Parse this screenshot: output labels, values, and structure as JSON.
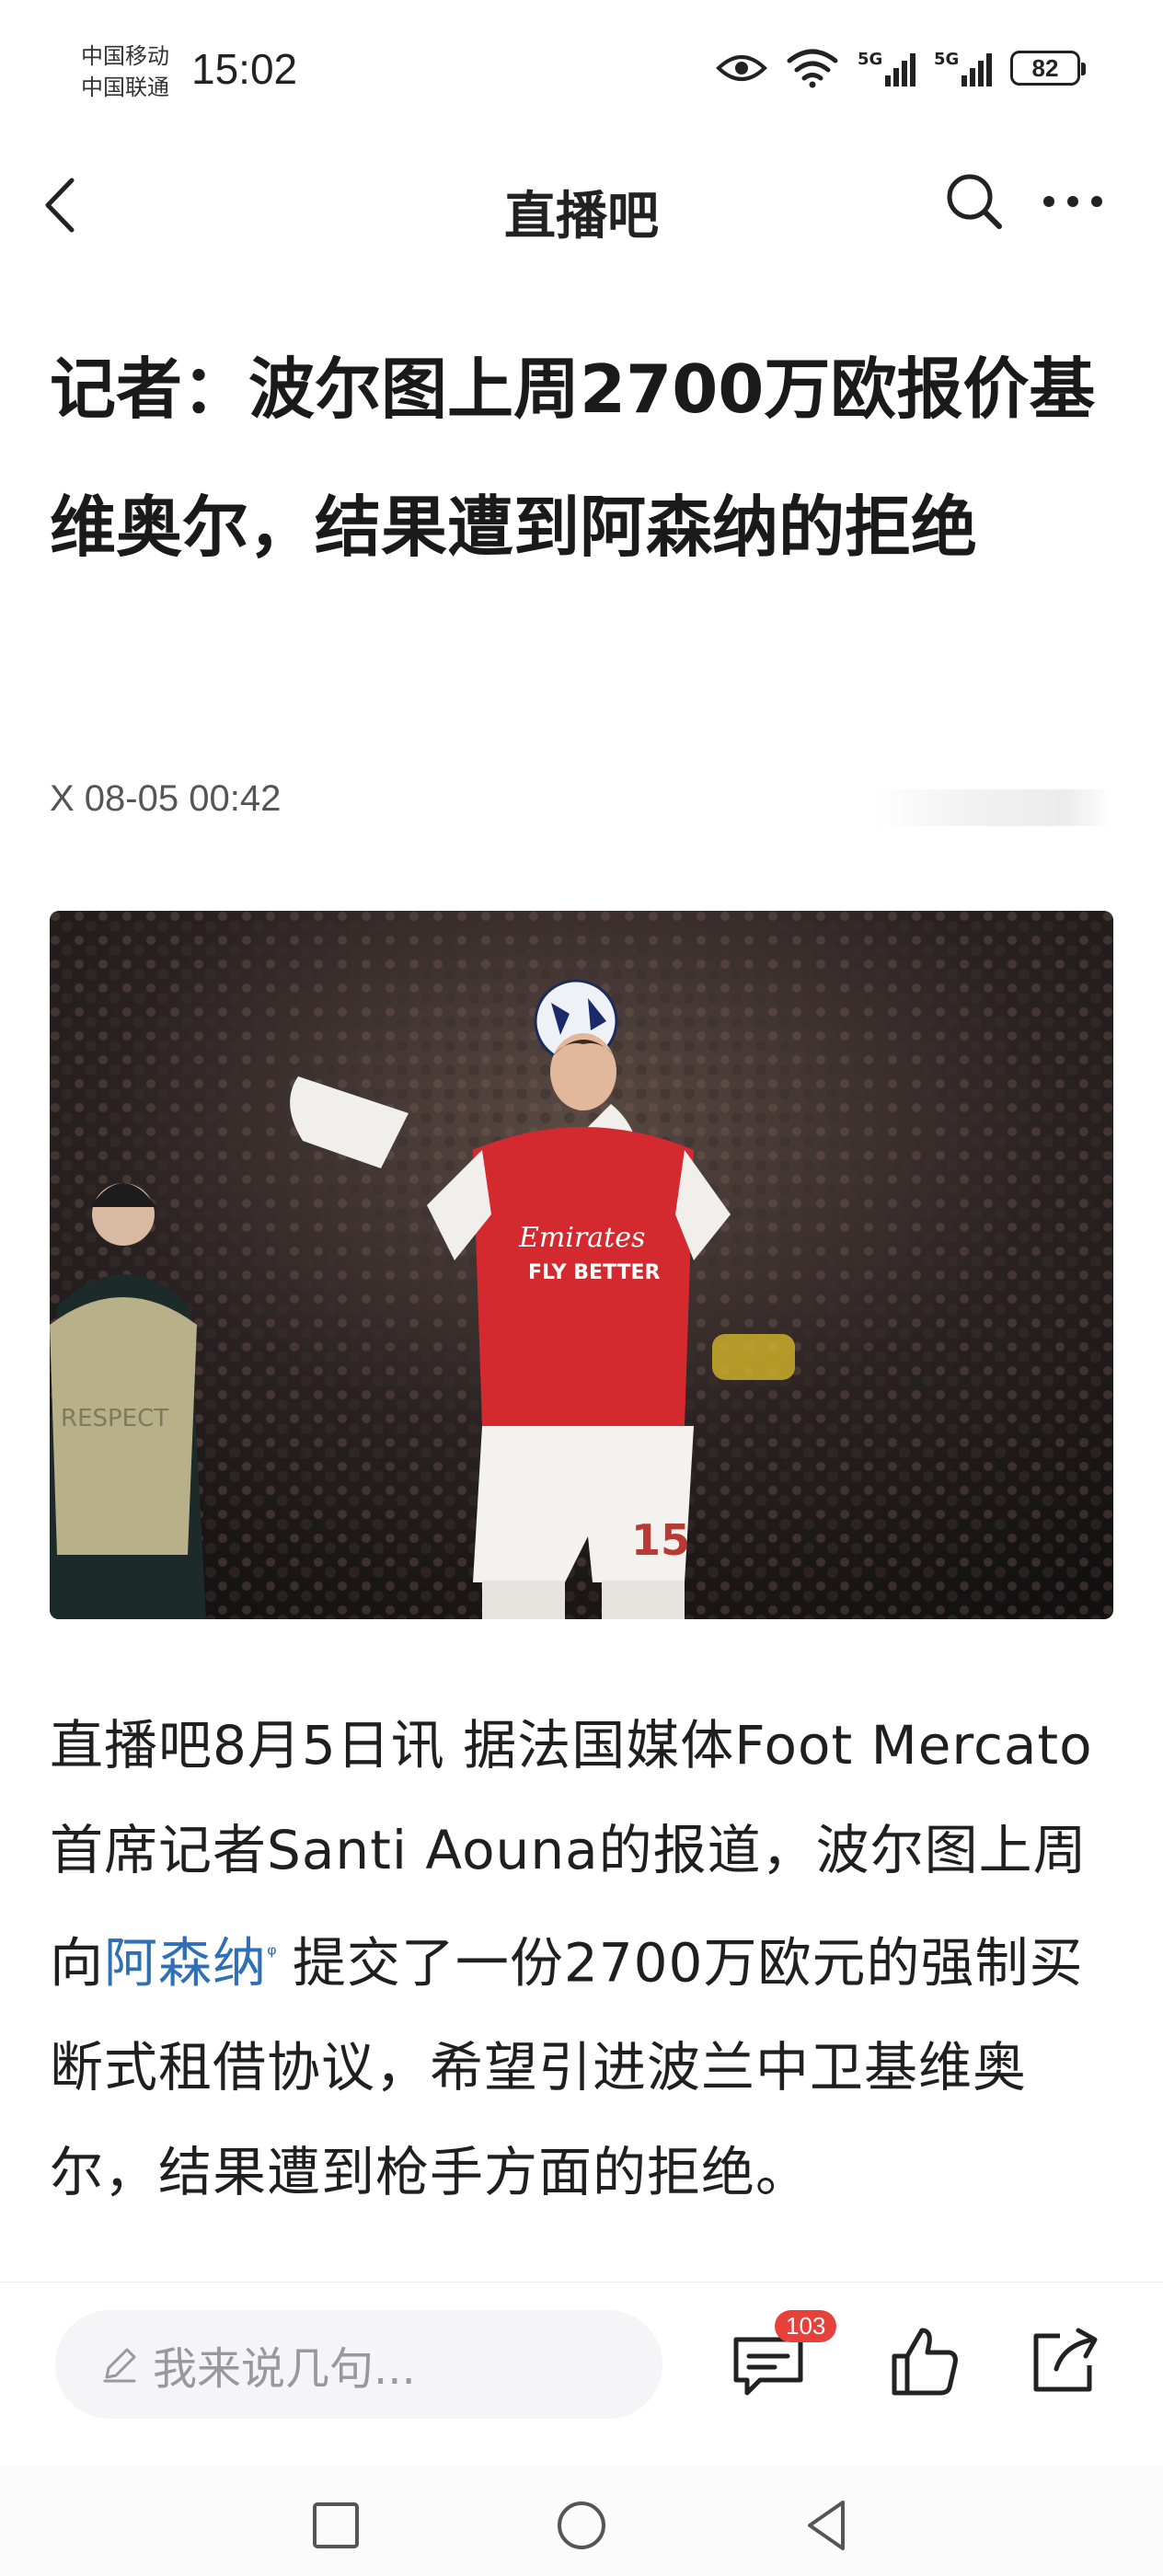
{
  "status_bar": {
    "carrier_1": "中国移动",
    "carrier_2": "中国联通",
    "time": "15:02",
    "network_1": "5G",
    "network_2": "5G",
    "battery": "82",
    "icons": [
      "eye-icon",
      "wifi-icon",
      "signal-icon",
      "signal-icon",
      "battery-icon"
    ]
  },
  "nav": {
    "title": "直播吧",
    "icons": [
      "back-arrow-icon",
      "search-icon",
      "more-icon"
    ]
  },
  "article": {
    "headline": "记者：波尔图上周2700万欧报价基维奥尔，结果遭到阿森纳的拒绝",
    "meta": "X  08-05 00:42",
    "image_description_alt": "",
    "body_part1": "直播吧8月5日讯 据法国媒体Foot Mercato首席记者Santi Aouna的报道，波尔图上周向",
    "body_link": "阿森纳",
    "body_part2": "提交了一份2700万欧元的强制买断式租借协议，希望引进波兰中卫基维奥尔，结果遭到枪手方面的拒绝。"
  },
  "hero_photo": {
    "shirt_sponsor_1": "Emirates",
    "shirt_sponsor_2": "FLY BETTER",
    "shorts_number": "15",
    "bib_text": "RESPECT"
  },
  "action_bar": {
    "comment_placeholder": "我来说几句...",
    "comment_count": "103",
    "icons": [
      "pencil-icon",
      "comment-icon",
      "like-icon",
      "share-icon"
    ]
  },
  "system_nav": {
    "icons": [
      "recent-apps-icon",
      "home-icon",
      "back-icon"
    ]
  },
  "colors": {
    "link": "#2f6fb6",
    "badge": "#e8413b",
    "jersey": "#d42a2f"
  }
}
